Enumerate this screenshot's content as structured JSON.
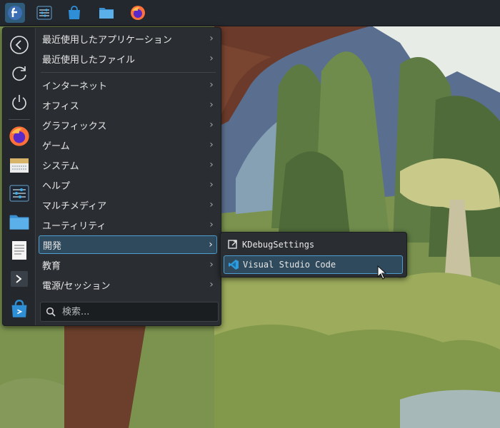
{
  "taskbar": {
    "icons": [
      "fedora-launcher-icon",
      "system-settings-icon",
      "discover-store-icon",
      "file-manager-icon",
      "firefox-icon"
    ]
  },
  "sidebar": {
    "favorites": [
      "back-icon",
      "restart-icon",
      "shutdown-icon",
      "firefox-icon",
      "archive-icon",
      "settings-icon",
      "file-manager-icon",
      "text-editor-icon",
      "terminal-icon",
      "discover-store-icon"
    ]
  },
  "menu": {
    "recent": [
      {
        "label": "最近使用したアプリケーション"
      },
      {
        "label": "最近使用したファイル"
      }
    ],
    "categories": [
      {
        "label": "インターネット"
      },
      {
        "label": "オフィス"
      },
      {
        "label": "グラフィックス"
      },
      {
        "label": "ゲーム"
      },
      {
        "label": "システム"
      },
      {
        "label": "ヘルプ"
      },
      {
        "label": "マルチメディア"
      },
      {
        "label": "ユーティリティ"
      },
      {
        "label": "開発",
        "selected": true
      },
      {
        "label": "教育"
      },
      {
        "label": "電源/セッション"
      }
    ],
    "chevron": "›",
    "search_placeholder": "検索..."
  },
  "submenu": {
    "items": [
      {
        "label": "KDebugSettings",
        "icon": "kdebugsettings-icon"
      },
      {
        "label": "Visual Studio Code",
        "icon": "vscode-icon",
        "selected": true
      }
    ]
  },
  "colors": {
    "panel": "#23272e",
    "menu_bg": "#2a2e32",
    "highlight_bg": "#2f4a5c",
    "highlight_border": "#4f9ed0"
  }
}
